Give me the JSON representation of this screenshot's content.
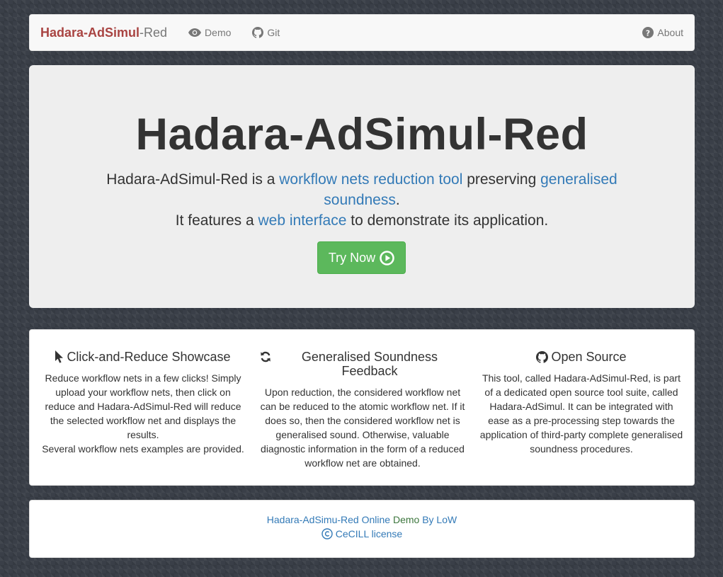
{
  "navbar": {
    "brand_main": "Hadara-AdSimul",
    "brand_suffix": "-Red",
    "demo": "Demo",
    "git": "Git",
    "about": "About"
  },
  "hero": {
    "title": "Hadara-AdSimul-Red",
    "line1_a": "Hadara-AdSimul-Red is a ",
    "line1_link1": "workflow nets reduction tool",
    "line1_b": " preserving ",
    "line1_link2": "generalised soundness",
    "line1_c": ".",
    "line2_a": "It features a ",
    "line2_link": "web interface",
    "line2_b": " to demonstrate its application.",
    "button": "Try Now"
  },
  "features": [
    {
      "title": "Click-and-Reduce Showcase",
      "icon": "cursor-icon",
      "text1": "Reduce workflow nets in a few clicks! Simply upload your workflow nets, then click on reduce and Hadara-AdSimul-Red will reduce the selected workflow net and displays the results.",
      "text2": "Several workflow nets examples are provided."
    },
    {
      "title": "Generalised Soundness Feedback",
      "icon": "refresh-icon",
      "text1": "Upon reduction, the considered workflow net can be reduced to the atomic workflow net. If it does so, then the considered workflow net is generalised sound. Otherwise, valuable diagnostic information in the form of a reduced workflow net are obtained."
    },
    {
      "title": "Open Source",
      "icon": "github-icon",
      "text1": "This tool, called Hadara-AdSimul-Red, is part of a dedicated open source tool suite, called Hadara-AdSimul. It can be integrated with ease as a pre-processing step towards the application of third-party complete generalised soundness procedures."
    }
  ],
  "footer": {
    "part1": "Hadara-AdSimu-Red Online",
    "part2": " Demo ",
    "part3": "By LoW",
    "license": "CeCILL license"
  },
  "colors": {
    "brand_red": "#a94442",
    "link_blue": "#337ab7",
    "button_green": "#5cb85c",
    "jumbotron_bg": "#eeeeee"
  }
}
